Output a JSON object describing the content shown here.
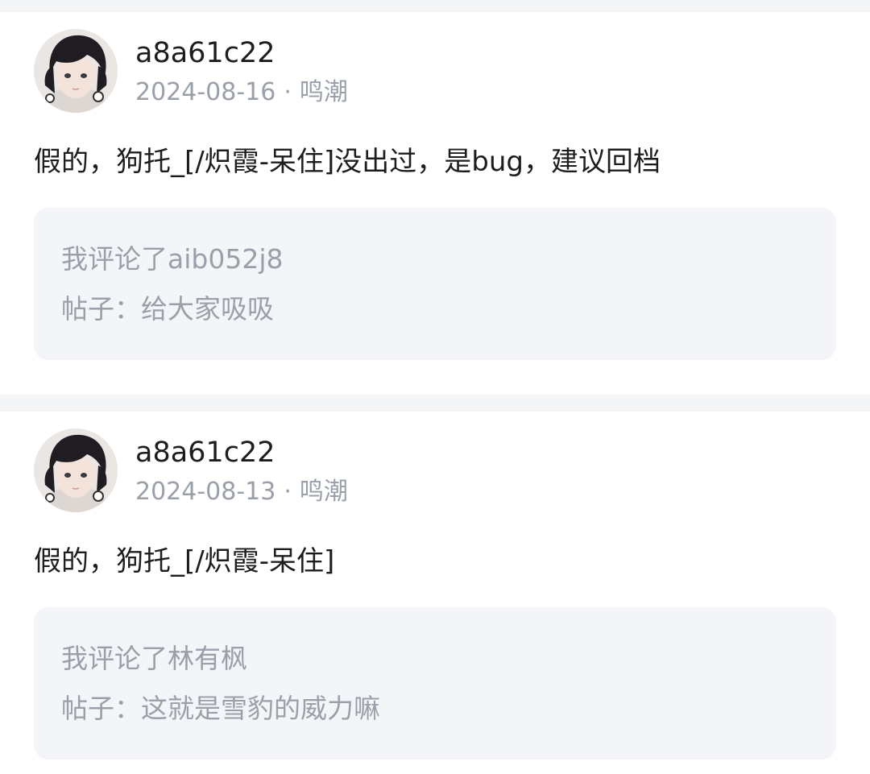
{
  "comments": [
    {
      "username": "a8a61c22",
      "date": "2024-08-16",
      "separator": "·",
      "game": "鸣潮",
      "content": "假的，狗托_[/炽霞-呆住]没出过，是bug，建议回档",
      "reference": {
        "line1": "我评论了aib052j8",
        "line2": "帖子：给大家吸吸"
      }
    },
    {
      "username": "a8a61c22",
      "date": "2024-08-13",
      "separator": "·",
      "game": "鸣潮",
      "content": "假的，狗托_[/炽霞-呆住]",
      "reference": {
        "line1": "我评论了林有枫",
        "line2": "帖子：这就是雪豹的威力嘛"
      }
    }
  ],
  "icons": {
    "avatar": "user-avatar-anime-girl"
  }
}
